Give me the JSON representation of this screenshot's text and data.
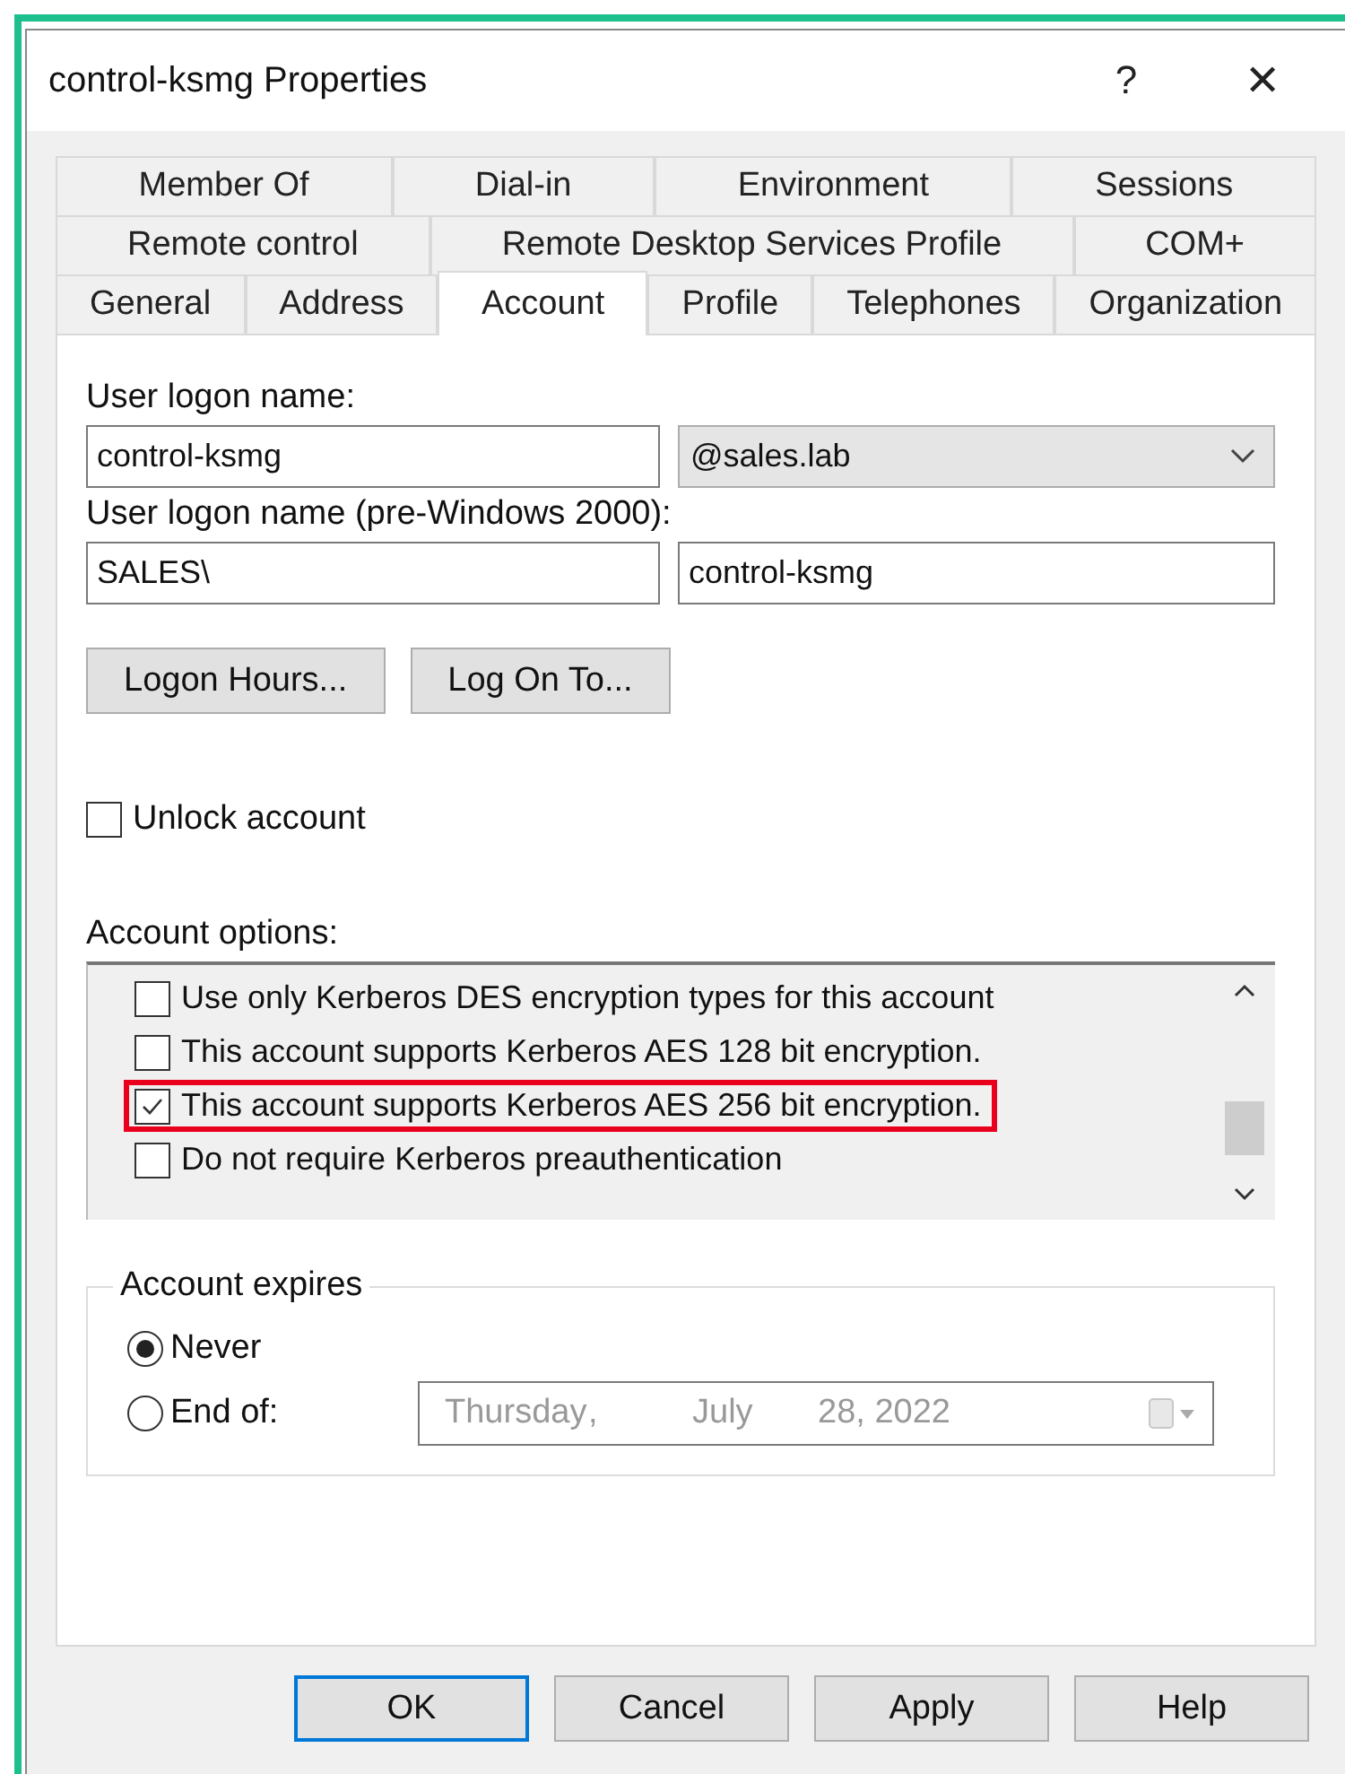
{
  "window": {
    "title": "control-ksmg Properties",
    "help_button": "?",
    "close_button": "✕"
  },
  "tab_rows": [
    [
      {
        "label": "Member Of",
        "selected": false
      },
      {
        "label": "Dial-in",
        "selected": false
      },
      {
        "label": "Environment",
        "selected": false
      },
      {
        "label": "Sessions",
        "selected": false
      }
    ],
    [
      {
        "label": "Remote control",
        "selected": false
      },
      {
        "label": "Remote Desktop Services Profile",
        "selected": false
      },
      {
        "label": "COM+",
        "selected": false
      }
    ],
    [
      {
        "label": "General",
        "selected": false
      },
      {
        "label": "Address",
        "selected": false
      },
      {
        "label": "Account",
        "selected": true
      },
      {
        "label": "Profile",
        "selected": false
      },
      {
        "label": "Telephones",
        "selected": false
      },
      {
        "label": "Organization",
        "selected": false
      }
    ]
  ],
  "logon_name": {
    "label": "User logon name:",
    "value": "control-ksmg",
    "domain": "@sales.lab"
  },
  "pre2000": {
    "label": "User logon name (pre-Windows 2000):",
    "domain": "SALES\\",
    "value": "control-ksmg"
  },
  "buttons_row": [
    "Logon Hours...",
    "Log On To..."
  ],
  "unlock": {
    "label": "Unlock account",
    "checked": false
  },
  "account_options": {
    "label": "Account options:",
    "items": [
      {
        "label": "Use only Kerberos DES encryption types for this account",
        "checked": false,
        "highlighted": false
      },
      {
        "label": "This account supports Kerberos AES 128 bit encryption.",
        "checked": false,
        "highlighted": false
      },
      {
        "label": "This account supports Kerberos AES 256 bit encryption.",
        "checked": true,
        "highlighted": true
      },
      {
        "label": "Do not require Kerberos preauthentication",
        "checked": false,
        "highlighted": false
      }
    ]
  },
  "account_expires": {
    "legend": "Account expires",
    "options": [
      {
        "label": "Never",
        "selected": true
      },
      {
        "label": "End of:",
        "selected": false
      }
    ],
    "date": {
      "parts": [
        "Thursday",
        ",",
        "July",
        "28, 2022"
      ],
      "disabled": true
    }
  },
  "footer_buttons": [
    {
      "label": "OK",
      "default": true
    },
    {
      "label": "Cancel",
      "default": false
    },
    {
      "label": "Apply",
      "default": false
    },
    {
      "label": "Help",
      "default": false
    }
  ]
}
